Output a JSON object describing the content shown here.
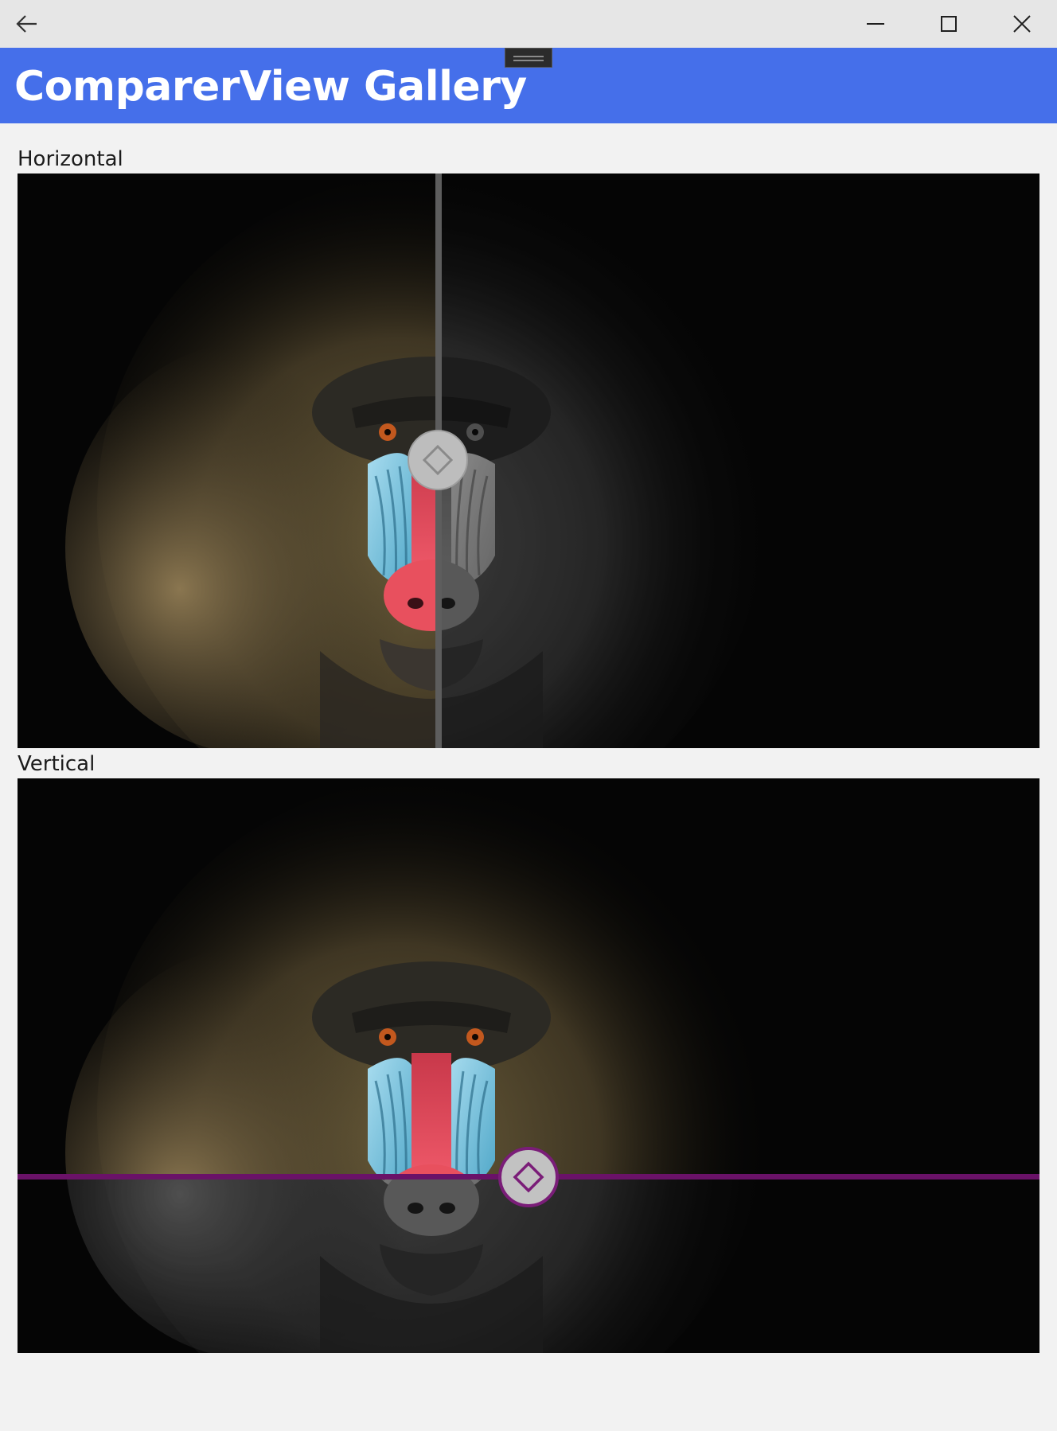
{
  "window": {
    "back_icon": "arrow-left-icon",
    "minimize_icon": "minimize-icon",
    "maximize_icon": "maximize-icon",
    "close_icon": "close-icon"
  },
  "header": {
    "title": "ComparerView Gallery",
    "background": "#456fea"
  },
  "sections": {
    "horizontal": {
      "label": "Horizontal",
      "before_image": "mandrill-color",
      "after_image": "mandrill-grayscale",
      "slider_position": 0.411,
      "divider_color": "#5d5d5d",
      "thumb_icon": "diamond-icon"
    },
    "vertical": {
      "label": "Vertical",
      "before_image": "mandrill-color",
      "after_image": "mandrill-grayscale",
      "slider_position": 0.692,
      "divider_color": "#6a1268",
      "thumb_icon": "diamond-icon"
    }
  }
}
